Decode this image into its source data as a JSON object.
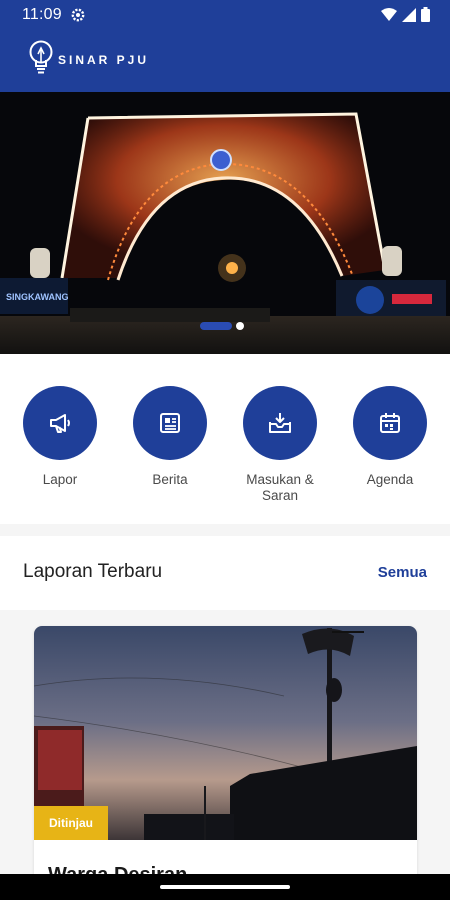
{
  "status": {
    "time": "11:09",
    "icons": [
      "gear-icon",
      "wifi-icon",
      "signal-icon",
      "battery-icon"
    ]
  },
  "app": {
    "name": "SINAR PJU",
    "brand_color": "#1f3f99"
  },
  "hero": {
    "sign_text": "SINGKAWANG",
    "slide_count": 2,
    "active_slide": 1
  },
  "menu": [
    {
      "label": "Lapor",
      "icon": "megaphone-icon"
    },
    {
      "label": "Berita",
      "icon": "newspaper-icon"
    },
    {
      "label": "Masukan & Saran",
      "icon": "inbox-icon"
    },
    {
      "label": "Agenda",
      "icon": "calendar-icon"
    }
  ],
  "section": {
    "title": "Laporan Terbaru",
    "link": "Semua"
  },
  "report": {
    "status": "Ditinjau",
    "status_color": "#e7b416",
    "title": "Warga Desiran"
  }
}
